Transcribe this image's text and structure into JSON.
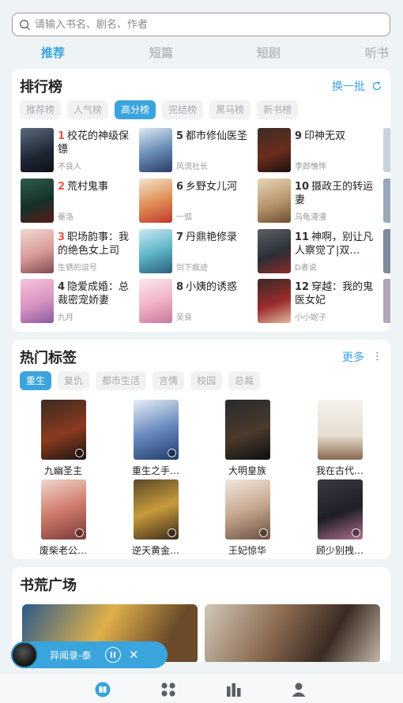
{
  "search": {
    "placeholder": "请输入书名、剧名、作者",
    "icon": "search-icon"
  },
  "tabs": [
    {
      "label": "推荐",
      "active": true
    },
    {
      "label": "短篇"
    },
    {
      "label": "短剧"
    },
    {
      "label": "听书"
    }
  ],
  "ranking": {
    "title": "排行榜",
    "refresh_label": "换一批",
    "filters": [
      {
        "label": "推荐榜"
      },
      {
        "label": "人气榜"
      },
      {
        "label": "高分榜",
        "active": true
      },
      {
        "label": "完结榜"
      },
      {
        "label": "黑马榜"
      },
      {
        "label": "新书榜"
      }
    ],
    "books": [
      {
        "num": "1",
        "title": "校花的神级保镖",
        "author": "不良人"
      },
      {
        "num": "2",
        "title": "荒村鬼事",
        "author": "墨洛"
      },
      {
        "num": "3",
        "title": "职场韵事：我的绝色女上司",
        "author": "生锈的逗号"
      },
      {
        "num": "4",
        "title": "隐爱成婚：总裁密宠娇妻",
        "author": "九月"
      },
      {
        "num": "5",
        "title": "都市修仙医圣",
        "author": "风流社长"
      },
      {
        "num": "6",
        "title": "乡野女儿河",
        "author": "一弧"
      },
      {
        "num": "7",
        "title": "丹鼎艳修录",
        "author": "剑下痕迹"
      },
      {
        "num": "8",
        "title": "小姨的诱惑",
        "author": "吴良"
      },
      {
        "num": "9",
        "title": "印神无双",
        "author": "李郎憔悴"
      },
      {
        "num": "10",
        "title": "摄政王的转运妻",
        "author": "乌龟漫漫"
      },
      {
        "num": "11",
        "title": "神啊，别让凡人察觉了|双…",
        "author": "D者说"
      },
      {
        "num": "12",
        "title": "穿越：我的鬼医女妃",
        "author": "小小妮子"
      }
    ]
  },
  "hot_tags": {
    "title": "热门标签",
    "more_label": "更多",
    "tags": [
      {
        "label": "重生",
        "active": true
      },
      {
        "label": "复仇"
      },
      {
        "label": "都市生活"
      },
      {
        "label": "言情"
      },
      {
        "label": "校园"
      },
      {
        "label": "总裁"
      }
    ],
    "books": [
      {
        "name": "九幽圣主"
      },
      {
        "name": "重生之手…"
      },
      {
        "name": "大明皇族"
      },
      {
        "name": "我在古代…"
      },
      {
        "name": "废柴老公…"
      },
      {
        "name": "逆天黄金…"
      },
      {
        "name": "王妃惊华"
      },
      {
        "name": "顾少别拽…"
      }
    ]
  },
  "plaza": {
    "title": "书荒广场"
  },
  "mini_player": {
    "title": "异闻录-泰"
  },
  "bottom_nav": [
    {
      "icon": "bookshelf-icon",
      "active": true
    },
    {
      "icon": "category-icon"
    },
    {
      "icon": "ranking-icon"
    },
    {
      "icon": "profile-icon"
    }
  ],
  "colors": {
    "accent": "#3aa4dc",
    "rank_number": "#e4594a",
    "background": "#eef4f6"
  }
}
